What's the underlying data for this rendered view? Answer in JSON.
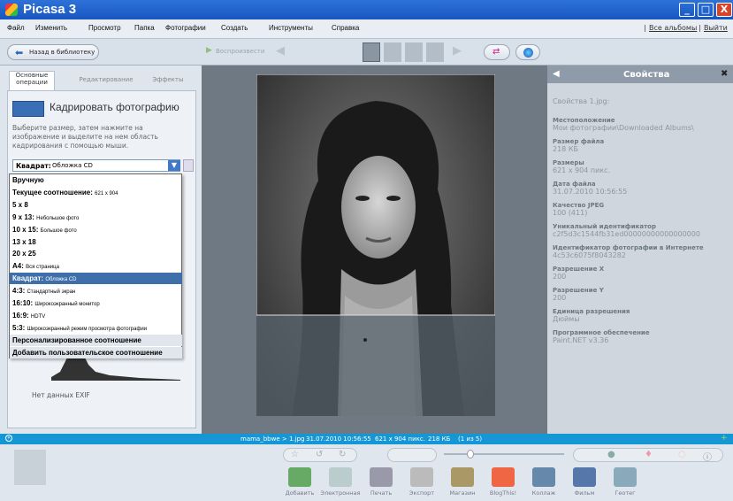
{
  "window": {
    "title": "Picasa 3",
    "minimize": "_",
    "maximize": "□",
    "close": "X"
  },
  "menu": {
    "items": [
      "Файл",
      "Изменить",
      "Просмотр",
      "Папка",
      "Фотографии",
      "Создать",
      "Инструменты",
      "Справка"
    ],
    "right_links": [
      "Все альбомы",
      "Выйти"
    ],
    "separator": "|"
  },
  "toolbar": {
    "back_label": "Назад в библиотеку",
    "play_label": "Воспроизвести"
  },
  "left_panel": {
    "tabs": [
      "Основные операции",
      "Редактирование",
      "Эффекты"
    ],
    "heading": "Кадрировать фотографию",
    "instructions": "Выберите размер, затем нажмите на изображение и выделите на нем область кадрирования с помощью мыши.",
    "selected_ratio": {
      "bold": "Квадрат:",
      "rest": "Обложка CD"
    },
    "exif": "Нет данных EXIF",
    "dropdown": [
      {
        "bold": "Вручную",
        "rest": ""
      },
      {
        "bold": "Текущее соотношение:",
        "rest": "621 x 904"
      },
      {
        "bold": "5 x 8",
        "rest": ""
      },
      {
        "bold": "9 x 13:",
        "rest": "Небольшое фото"
      },
      {
        "bold": "10 x 15:",
        "rest": "Большое фото"
      },
      {
        "bold": "13 x 18",
        "rest": ""
      },
      {
        "bold": "20 x 25",
        "rest": ""
      },
      {
        "bold": "A4:",
        "rest": "Вся страница"
      },
      {
        "bold": "Квадрат:",
        "rest": "Обложка CD",
        "selected": true
      },
      {
        "bold": "4:3:",
        "rest": "Стандартный экран"
      },
      {
        "bold": "16:10:",
        "rest": "Широкоэкранный монитор"
      },
      {
        "bold": "16:9:",
        "rest": "HDTV"
      },
      {
        "bold": "5:3:",
        "rest": "Широкоэкранный режим просмотра фотографии"
      },
      {
        "bold": "Персонализированное соотношение",
        "rest": "",
        "footer": true
      },
      {
        "bold": "Добавить пользовательское соотношение",
        "rest": "",
        "footer": true
      }
    ]
  },
  "properties": {
    "title": "Свойства",
    "file_caption": "Свойства 1.jpg:",
    "items": [
      {
        "label": "Местоположение",
        "value": "Мои фотографии\\Downloaded Albums\\"
      },
      {
        "label": "Размер файла",
        "value": "218 КБ"
      },
      {
        "label": "Размеры",
        "value": "621 x 904 пикс."
      },
      {
        "label": "Дата файла",
        "value": "31.07.2010 10:56:55"
      },
      {
        "label": "Качество JPEG",
        "value": "100 (411)"
      },
      {
        "label": "Уникальный идентификатор",
        "value": "c2f5d3c1544fb31ed00000000000000000"
      },
      {
        "label": "Идентификатор фотографии в Интернете",
        "value": "4c53c6075f8043282"
      },
      {
        "label": "Разрешение X",
        "value": "200"
      },
      {
        "label": "Разрешение Y",
        "value": "200"
      },
      {
        "label": "Единица разрешения",
        "value": "Дюймы"
      },
      {
        "label": "Программное обеспечение",
        "value": "Paint.NET v3.36"
      }
    ]
  },
  "status": {
    "filename": "mama_bbwe > 1.jpg",
    "date": "31.07.2010 10:56:55",
    "dims": "621 x 904 пикс.",
    "size": "218 КБ",
    "index": "(1 из 5)"
  },
  "bottom_actions": [
    "Добавить",
    "Электронная",
    "Печать",
    "Экспорт",
    "Магазин",
    "BlogThis!",
    "Коллаж",
    "Фильм",
    "Геотег"
  ],
  "colors": {
    "titlebar": "#1c5cc6",
    "status": "#1597d6",
    "properties_header": "#8f9ba8",
    "selected_row": "#3f6fab"
  }
}
